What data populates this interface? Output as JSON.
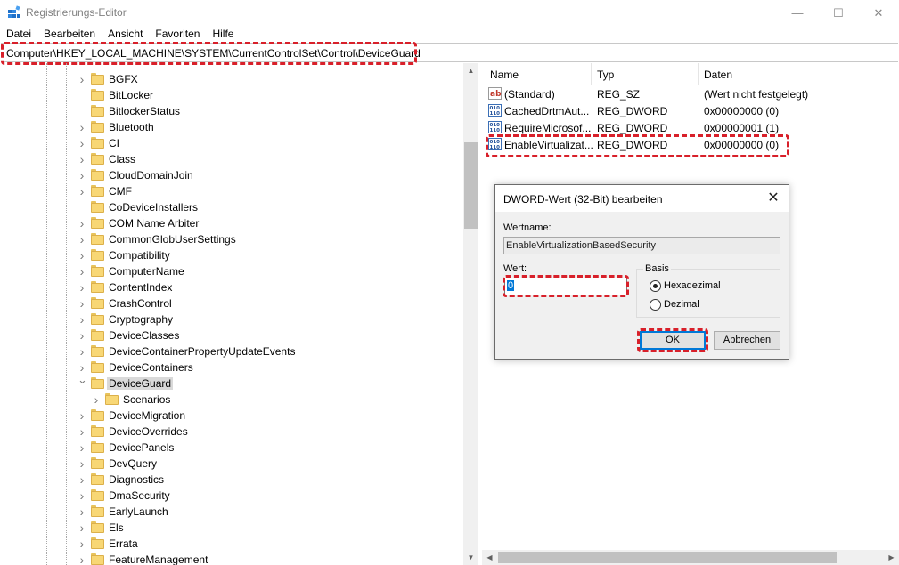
{
  "window": {
    "title": "Registrierungs-Editor",
    "minimize_glyph": "—",
    "maximize_glyph": "☐",
    "close_glyph": "✕",
    "icon": "regedit-icon"
  },
  "menu": [
    "Datei",
    "Bearbeiten",
    "Ansicht",
    "Favoriten",
    "Hilfe"
  ],
  "address": {
    "path": "Computer\\HKEY_LOCAL_MACHINE\\SYSTEM\\CurrentControlSet\\Control\\DeviceGuard"
  },
  "tree": {
    "items": [
      {
        "label": "BGFX",
        "expandable": true
      },
      {
        "label": "BitLocker",
        "expandable": false
      },
      {
        "label": "BitlockerStatus",
        "expandable": false
      },
      {
        "label": "Bluetooth",
        "expandable": true
      },
      {
        "label": "CI",
        "expandable": true
      },
      {
        "label": "Class",
        "expandable": true
      },
      {
        "label": "CloudDomainJoin",
        "expandable": true
      },
      {
        "label": "CMF",
        "expandable": true
      },
      {
        "label": "CoDeviceInstallers",
        "expandable": false
      },
      {
        "label": "COM Name Arbiter",
        "expandable": true
      },
      {
        "label": "CommonGlobUserSettings",
        "expandable": true
      },
      {
        "label": "Compatibility",
        "expandable": true
      },
      {
        "label": "ComputerName",
        "expandable": true
      },
      {
        "label": "ContentIndex",
        "expandable": true
      },
      {
        "label": "CrashControl",
        "expandable": true
      },
      {
        "label": "Cryptography",
        "expandable": true
      },
      {
        "label": "DeviceClasses",
        "expandable": true
      },
      {
        "label": "DeviceContainerPropertyUpdateEvents",
        "expandable": true
      },
      {
        "label": "DeviceContainers",
        "expandable": true
      },
      {
        "label": "DeviceGuard",
        "expandable": true,
        "expanded": true,
        "selected": true
      },
      {
        "label": "Scenarios",
        "expandable": true,
        "child": true
      },
      {
        "label": "DeviceMigration",
        "expandable": true
      },
      {
        "label": "DeviceOverrides",
        "expandable": true
      },
      {
        "label": "DevicePanels",
        "expandable": true
      },
      {
        "label": "DevQuery",
        "expandable": true
      },
      {
        "label": "Diagnostics",
        "expandable": true
      },
      {
        "label": "DmaSecurity",
        "expandable": true
      },
      {
        "label": "EarlyLaunch",
        "expandable": true
      },
      {
        "label": "Els",
        "expandable": true
      },
      {
        "label": "Errata",
        "expandable": true
      },
      {
        "label": "FeatureManagement",
        "expandable": true
      }
    ]
  },
  "list": {
    "columns": [
      "Name",
      "Typ",
      "Daten"
    ],
    "rows": [
      {
        "icon": "string-value-icon",
        "name": "(Standard)",
        "type": "REG_SZ",
        "data": "(Wert nicht festgelegt)"
      },
      {
        "icon": "binary-value-icon",
        "name": "CachedDrtmAut...",
        "type": "REG_DWORD",
        "data": "0x00000000 (0)"
      },
      {
        "icon": "binary-value-icon",
        "name": "RequireMicrosof...",
        "type": "REG_DWORD",
        "data": "0x00000001 (1)"
      },
      {
        "icon": "binary-value-icon",
        "name": "EnableVirtualizat...",
        "type": "REG_DWORD",
        "data": "0x00000000 (0)",
        "selected": true
      }
    ]
  },
  "dialog": {
    "title": "DWORD-Wert (32-Bit) bearbeiten",
    "close_glyph": "✕",
    "name_label": "Wertname:",
    "name_value": "EnableVirtualizationBasedSecurity",
    "value_label": "Wert:",
    "value": "0",
    "base_label": "Basis",
    "radio_hex": "Hexadezimal",
    "radio_dec": "Dezimal",
    "selected_base": "Hexadezimal",
    "ok_label": "OK",
    "cancel_label": "Abbrechen"
  },
  "colors": {
    "highlight_dash": "#d8202a",
    "selection_blue": "#0078d7",
    "folder_yellow": "#f8d775"
  }
}
